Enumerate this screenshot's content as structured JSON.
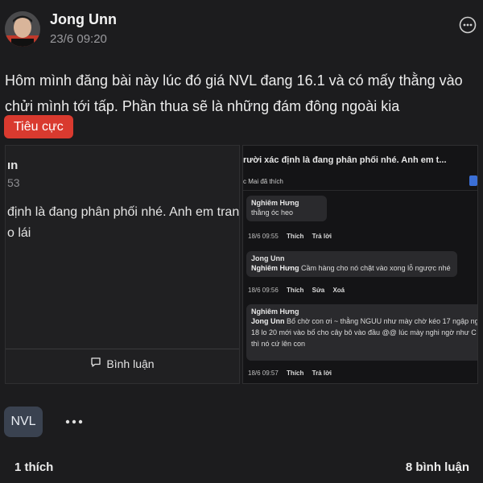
{
  "post": {
    "author": "Jong Unn",
    "time": "23/6 09:20",
    "text": "Hôm mình đăng bài này lúc đó giá NVL đang 16.1 và có mấy thằng vào chửi mình tới tấp. Phần thua sẽ là những đám đông ngoài kia",
    "tag": "Tiêu cực",
    "tag_color": "#d93a2f"
  },
  "image_left": {
    "name_fragment": "ın",
    "time_fragment": "53",
    "text_line1": "định là đang phân phối nhé. Anh em tranh th",
    "text_line2": "o lái",
    "comment_label": "Bình luận"
  },
  "image_right": {
    "header_fragment": "rười xác định là đang phân phối nhé. Anh em t...",
    "liked_by": "c Mai đã thích",
    "comments": [
      {
        "name": "Nghiêm Hưng",
        "lines": [
          "thằng óc heo"
        ],
        "time": "18/6 09:55",
        "actions": [
          "Thích",
          "Trả lời"
        ]
      },
      {
        "name": "Jong Unn",
        "mention": "Nghiêm Hưng",
        "lines": [
          "Cầm hàng cho nó chặt vào xong lỗ ngược nhé"
        ],
        "time": "18/6 09:56",
        "actions": [
          "Thích",
          "Sửa",
          "Xoá"
        ]
      },
      {
        "name": "Nghiêm Hưng",
        "mention": "Jong Unn",
        "lines": [
          "Bố chờ con ơi ~ thằng NGUU như mày chờ kéo 17 ngập ng",
          "18 lo 20 mới vào bố cho cây bô vào đầu @@ lúc mày nghi ngờ như C",
          "thì nó cứ lên con"
        ],
        "time": "18/6 09:57",
        "actions": [
          "Thích",
          "Trả lời"
        ]
      }
    ]
  },
  "footer": {
    "topic_tag": "NVL",
    "likes": "1 thích",
    "comments": "8 bình luận"
  },
  "icons": {
    "top_more": "more-horizontal-circle-icon",
    "more": "more-dots-icon",
    "comment": "comment-bubble-icon",
    "avatar": "avatar-image"
  }
}
